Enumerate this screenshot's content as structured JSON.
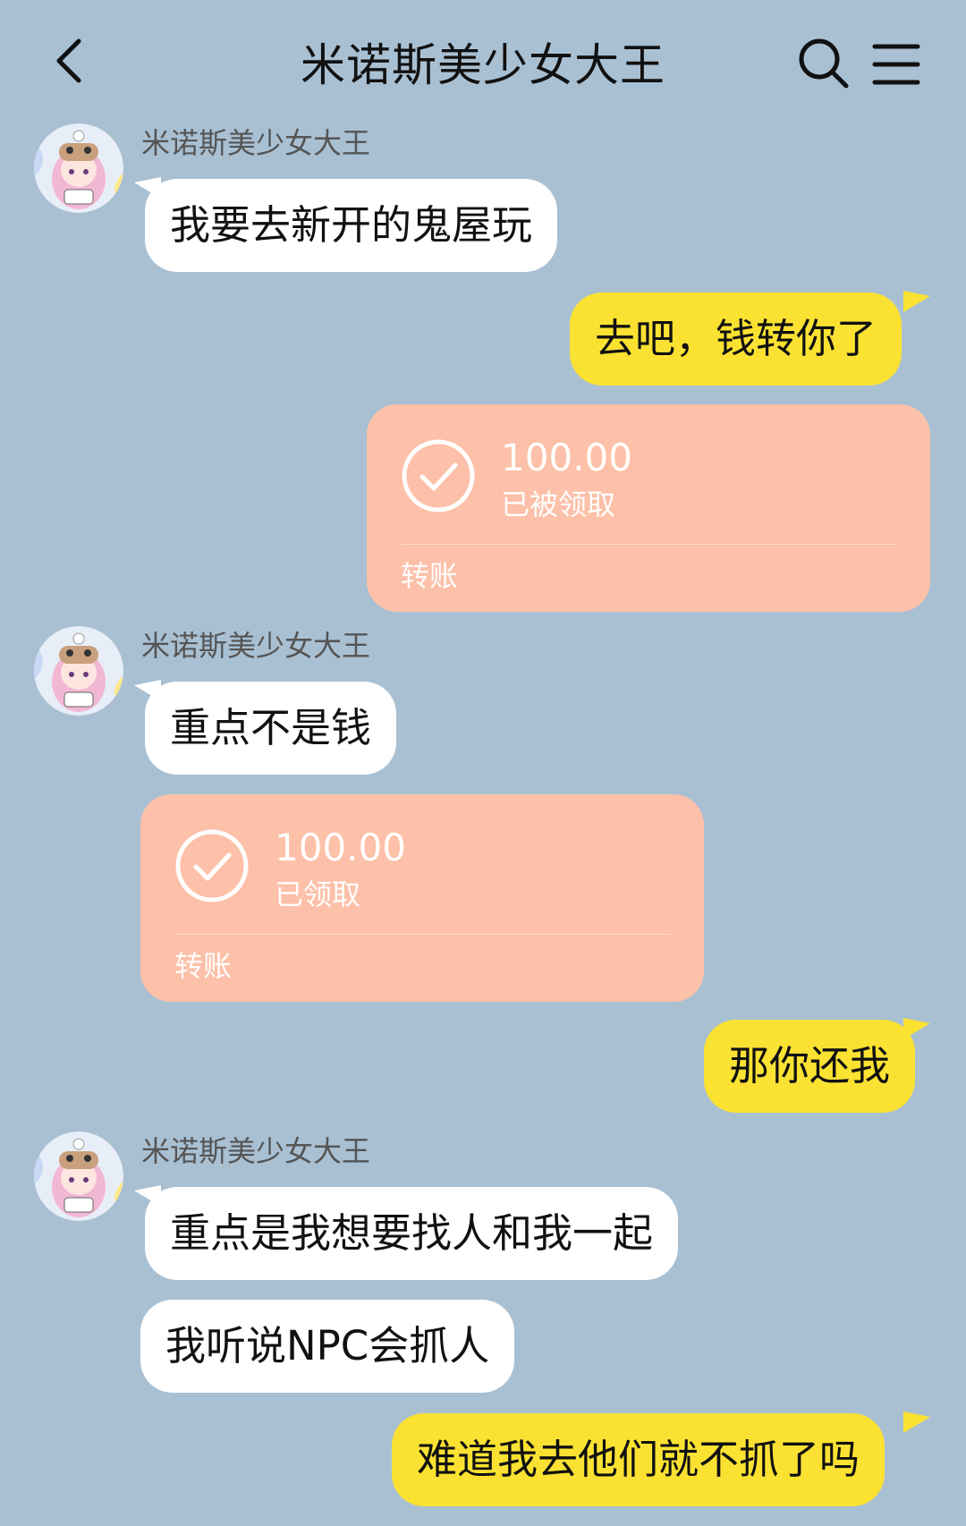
{
  "header": {
    "title": "米诺斯美少女大王",
    "back_icon": "chevron-left-icon",
    "search_icon": "search-icon",
    "menu_icon": "menu-icon"
  },
  "messages": [
    {
      "type": "name",
      "text": "米诺斯美少女大王"
    },
    {
      "type": "bubble_in",
      "text": "我要去新开的鬼屋玩"
    },
    {
      "type": "bubble_out",
      "text": "去吧，钱转你了"
    },
    {
      "type": "transfer_out",
      "amount": "100.00",
      "status": "已被领取",
      "label": "转账"
    },
    {
      "type": "name",
      "text": "米诺斯美少女大王"
    },
    {
      "type": "bubble_in",
      "text": "重点不是钱"
    },
    {
      "type": "transfer_in",
      "amount": "100.00",
      "status": "已领取",
      "label": "转账"
    },
    {
      "type": "bubble_out",
      "text": "那你还我"
    },
    {
      "type": "name",
      "text": "米诺斯美少女大王"
    },
    {
      "type": "bubble_in",
      "text": "重点是我想要找人和我一起"
    },
    {
      "type": "bubble_in",
      "text": "我听说NPC会抓人"
    },
    {
      "type": "bubble_out",
      "text": "难道我去他们就不抓了吗"
    }
  ],
  "colors": {
    "background": "#a9c0d3",
    "incoming_bubble": "#ffffff",
    "outgoing_bubble": "#fbe232",
    "transfer_card": "#fdc0a8"
  }
}
